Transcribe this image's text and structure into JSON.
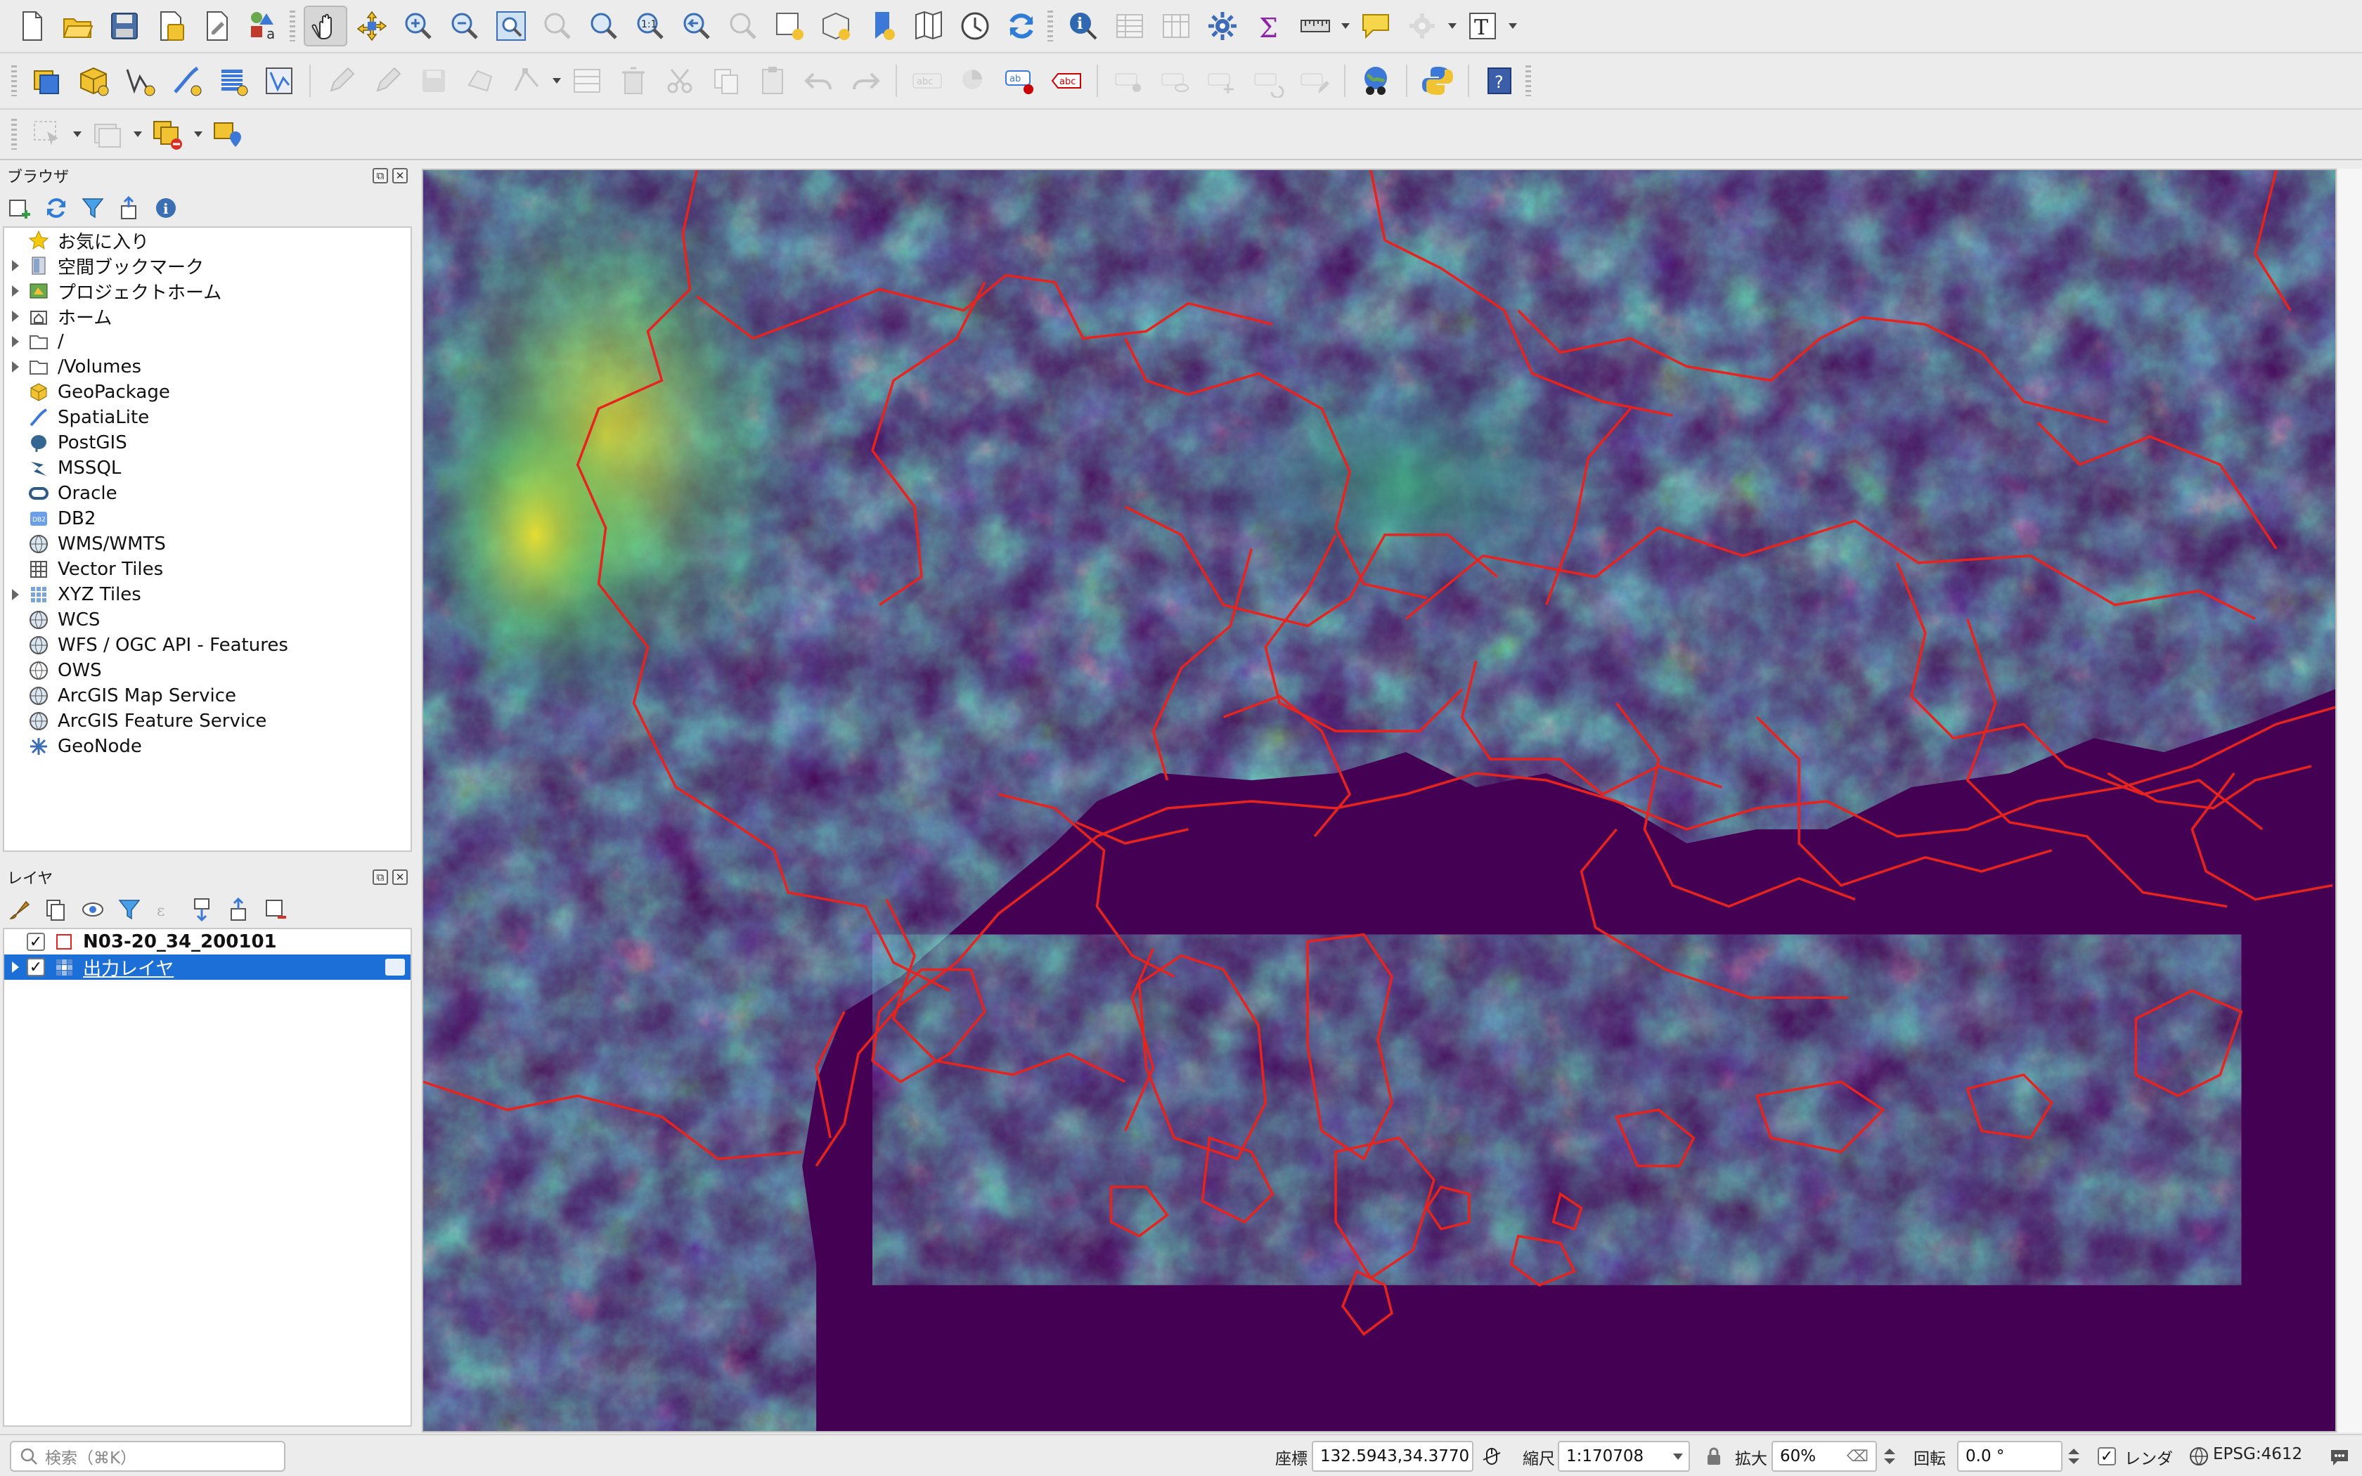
{
  "browser": {
    "title": "ブラウザ",
    "items": [
      {
        "label": "お気に入り",
        "icon": "star-icon",
        "expandable": false
      },
      {
        "label": "空間ブックマーク",
        "icon": "bookmark-icon",
        "expandable": true
      },
      {
        "label": "プロジェクトホーム",
        "icon": "project-home-icon",
        "expandable": true
      },
      {
        "label": "ホーム",
        "icon": "home-folder-icon",
        "expandable": true
      },
      {
        "label": "/",
        "icon": "folder-icon",
        "expandable": true
      },
      {
        "label": "/Volumes",
        "icon": "folder-icon",
        "expandable": true
      },
      {
        "label": "GeoPackage",
        "icon": "geopackage-icon",
        "expandable": false
      },
      {
        "label": "SpatiaLite",
        "icon": "spatialite-icon",
        "expandable": false
      },
      {
        "label": "PostGIS",
        "icon": "postgis-icon",
        "expandable": false
      },
      {
        "label": "MSSQL",
        "icon": "mssql-icon",
        "expandable": false
      },
      {
        "label": "Oracle",
        "icon": "oracle-icon",
        "expandable": false
      },
      {
        "label": "DB2",
        "icon": "db2-icon",
        "expandable": false
      },
      {
        "label": "WMS/WMTS",
        "icon": "wms-globe-icon",
        "expandable": false
      },
      {
        "label": "Vector Tiles",
        "icon": "vector-tiles-icon",
        "expandable": false
      },
      {
        "label": "XYZ Tiles",
        "icon": "xyz-tiles-icon",
        "expandable": true
      },
      {
        "label": "WCS",
        "icon": "wcs-globe-icon",
        "expandable": false
      },
      {
        "label": "WFS / OGC API - Features",
        "icon": "wfs-globe-icon",
        "expandable": false
      },
      {
        "label": "OWS",
        "icon": "ows-globe-icon",
        "expandable": false
      },
      {
        "label": "ArcGIS Map Service",
        "icon": "arcgis-map-icon",
        "expandable": false
      },
      {
        "label": "ArcGIS Feature Service",
        "icon": "arcgis-feature-icon",
        "expandable": false
      },
      {
        "label": "GeoNode",
        "icon": "geonode-icon",
        "expandable": false
      }
    ]
  },
  "layers": {
    "title": "レイヤ",
    "items": [
      {
        "label": "N03-20_34_200101",
        "checked": true,
        "selected": false,
        "expandable": false,
        "icon": "polygon-layer-swatch-icon"
      },
      {
        "label": "出力レイヤ",
        "checked": true,
        "selected": true,
        "expandable": true,
        "icon": "raster-layer-icon"
      }
    ]
  },
  "status": {
    "search_placeholder": "検索（⌘K）",
    "coord_label": "座標",
    "coord_value": "132.5943,34.3770",
    "scale_label": "縮尺",
    "scale_value": "1:170708",
    "magnifier_label": "拡大",
    "magnifier_value": "60%",
    "rotation_label": "回転",
    "rotation_value": "0.0 °",
    "render_label": "レンダ",
    "render_checked": true,
    "crs_label": "EPSG:4612"
  },
  "map": {
    "colormap": "viridis",
    "boundary_color": "#e8231d",
    "sea_color": "#440154"
  }
}
